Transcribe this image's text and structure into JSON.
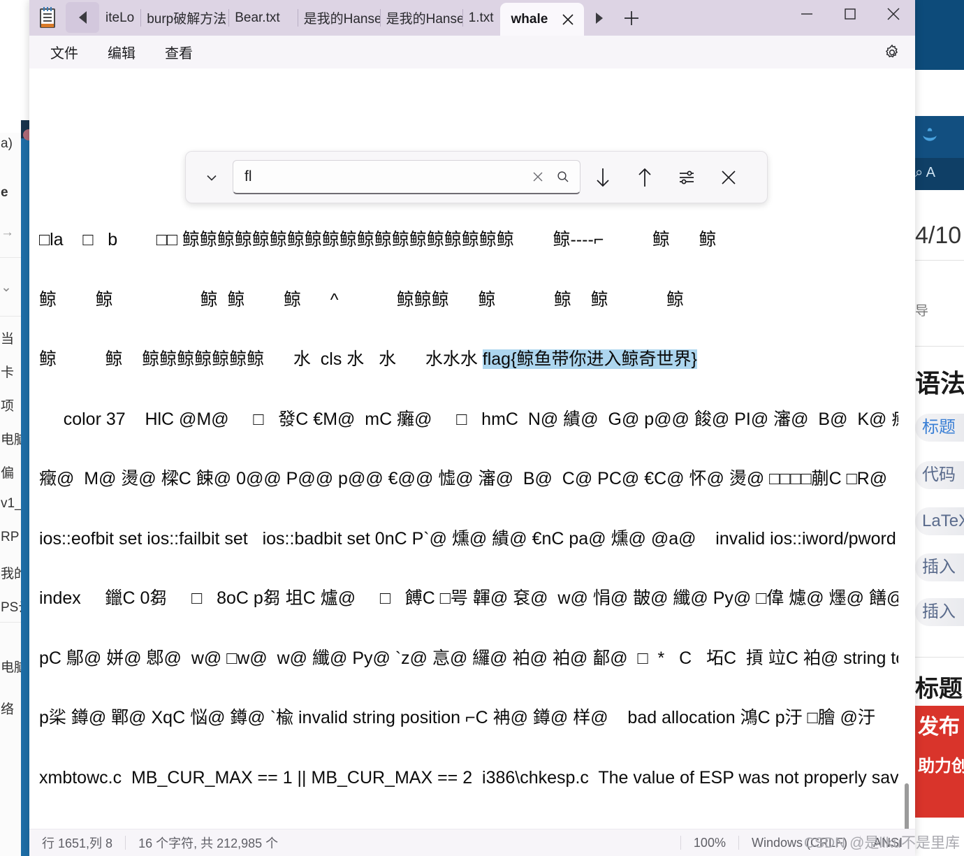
{
  "window": {
    "app_icon": "notepad-icon",
    "scroll_left_icon": "triangle-left-icon",
    "scroll_right_icon": "triangle-right-icon",
    "new_tab_icon": "plus-icon",
    "minimize_icon": "minimize-icon",
    "maximize_icon": "maximize-icon",
    "close_icon": "close-icon",
    "tabs": [
      {
        "label": "iteLo",
        "active": false
      },
      {
        "label": "burp破解方法",
        "active": false
      },
      {
        "label": "Bear.txt",
        "active": false
      },
      {
        "label": "是我的Hanse",
        "active": false
      },
      {
        "label": "是我的Hanse",
        "active": false
      },
      {
        "label": "1.txt",
        "active": false
      },
      {
        "label": "whale",
        "active": true,
        "close_icon": "close-icon"
      }
    ]
  },
  "menubar": {
    "items": [
      "文件",
      "编辑",
      "查看"
    ],
    "settings_icon": "gear-icon"
  },
  "findbar": {
    "expand_icon": "chevron-down-icon",
    "query": "fl",
    "placeholder": "",
    "clear_icon": "clear-x-icon",
    "search_icon": "search-icon",
    "find_next_icon": "arrow-down-icon",
    "find_prev_icon": "arrow-up-icon",
    "options_icon": "sliders-icon",
    "close_icon": "close-icon"
  },
  "document": {
    "lines": [
      "□la    □   b        □□ 鲸鲸鲸鲸鲸鲸鲸鲸鲸鲸鲸鲸鲸鲸鲸鲸鲸鲸鲸        鲸----⌐          鲸      鲸",
      "鲸        鲸                  鲸  鲸        鲸      ^            鲸鲸鲸      鲸            鲸    鲸            鲸",
      "鲸          鲸    鲸鲸鲸鲸鲸鲸鲸      水  cls 水   水      水水水 ",
      "     color 37    HlC @M@     □   發C €M@  mC 癱@     □   hmC  N@ 繢@  G@ p@@ 餕@ PI@ 瀋@  B@  K@ 癒@",
      "癥@  M@ 燙@ 樑C 餗@ 0@@ P@@ p@@ €@@ 憈@ 瀋@  B@  C@ PC@ €C@ 怀@ 燙@ □□□□蒯C □R@",
      "ios::eofbit set ios::failbit set   ios::badbit set 0nC P`@ 燻@ 繢@ €nC pa@ 燻@ @a@    invalid ios::iword/pword",
      "index     鑞C 0芻     □   8oC p芻 坥C 爐@     □   餺C □咢 韗@ 袞@  w@ 悁@ 皵@ 纖@ Py@ □偉 爈@ 爅@ 饍@ 鄐@",
      "pC 鄥@ 姘@ 鄎@  w@ □w@  w@ 纖@ Py@ `z@ 悥@ 纙@ 袙@ 袙@ 鄐@  □  *   C   坧C  摃 竝C 袙@ string too long □qC",
      "p桬 鐏@ 鄲@ XqC 悩@ 鐏@ `楡 invalid string position ⌐C 袡@ 鐏@ 样@    bad allocation 鴻C p汙 □膾 @汙",
      "xmbtowc.c  MB_CUR_MAX == 1 || MB_CUR_MAX == 2  i386\\chkesp.c  The value of ESP was not properly saved"
    ],
    "highlight": {
      "line_index": 2,
      "text": "flag{鲸鱼带你进入鲸奇世界}"
    },
    "scrollbar": "vertical-scrollbar"
  },
  "statusbar": {
    "cursor_position": "行 1651,列 8",
    "char_count": "16 个字符, 共 212,985 个",
    "zoom": "100%",
    "line_ending": "Windows (CRLF)",
    "encoding": "ANSI",
    "watermark": "CSDN @是liku不是里库"
  },
  "background": {
    "left_items": [
      "当",
      "卡",
      "项",
      "电脑",
      "偏",
      "v1_",
      "RP",
      "我的",
      "PS云",
      "电脑",
      "络"
    ],
    "left_top_items": [
      "a)",
      "e",
      "→",
      "⌄"
    ],
    "right_date": "4/10",
    "right_heading": "语法",
    "right_pills": [
      "标题",
      "代码",
      "LaTeX",
      "插入",
      "插入"
    ],
    "right_subheading": "标题",
    "right_banner": [
      "发布",
      "助力创"
    ],
    "right_nav_mark": "导",
    "right_whale_icon": "whale-icon",
    "right_search_icon": "search-icon",
    "accent_navy": "#0d4b7a",
    "accent_red": "#d9342b"
  }
}
